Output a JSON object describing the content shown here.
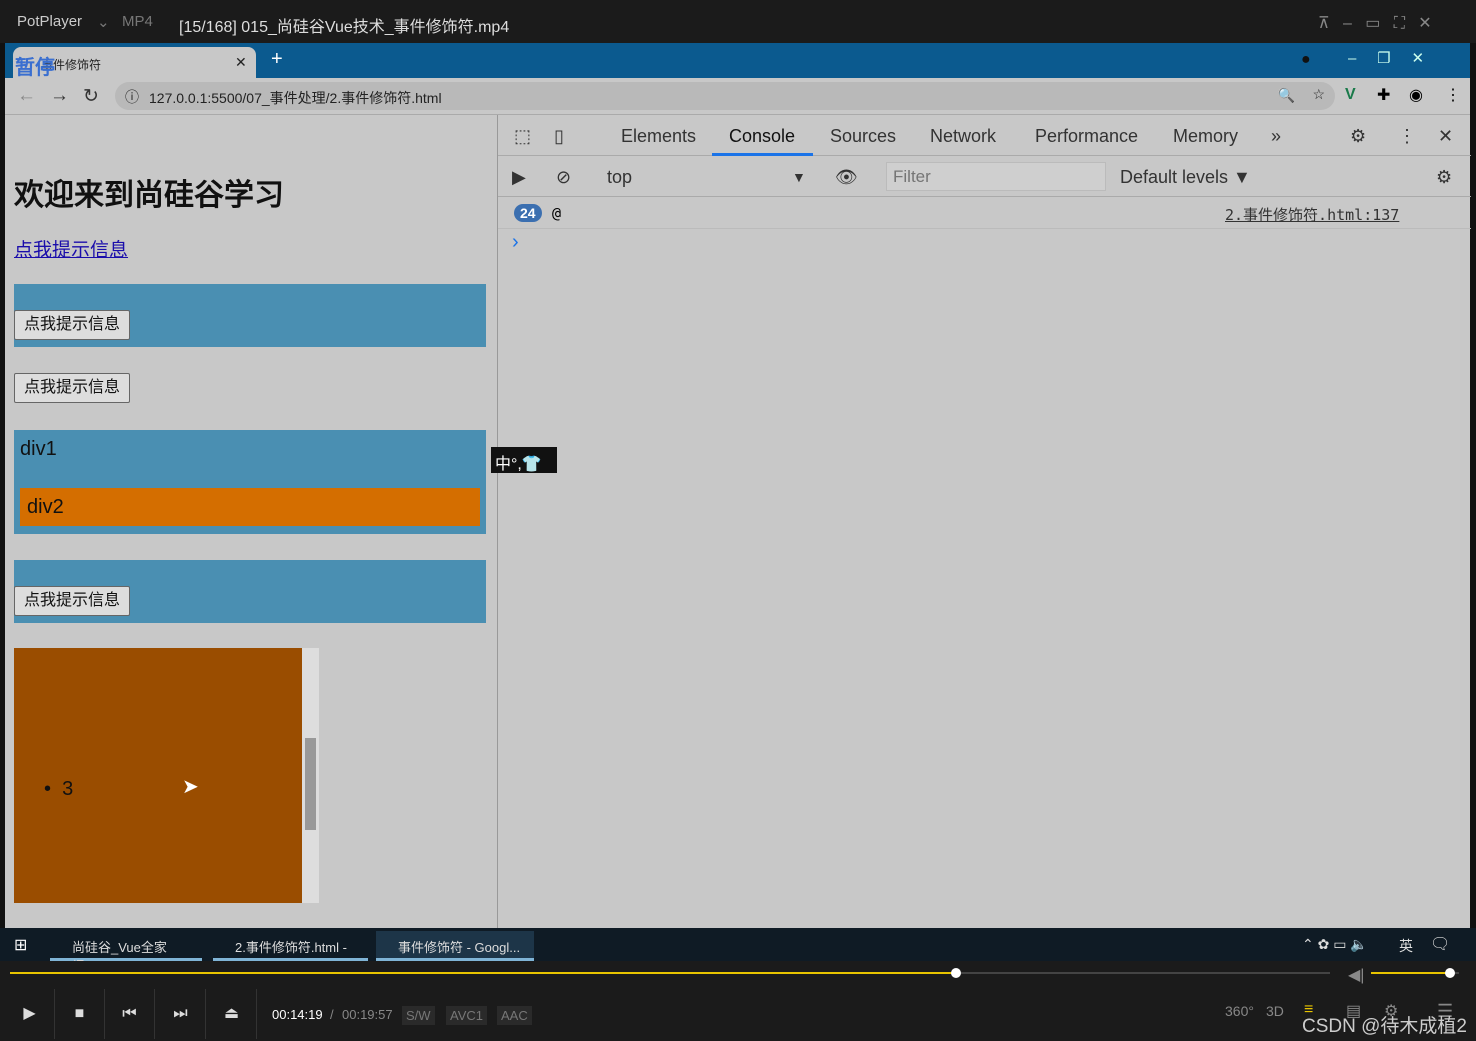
{
  "player": {
    "app_name": "PotPlayer",
    "format": "MP4",
    "title": "[15/168] 015_尚硅谷Vue技术_事件修饰符.mp4",
    "time_current": "00:14:19",
    "time_total": "00:19:57",
    "tags": [
      "S/W",
      "AVC1",
      "AAC"
    ],
    "progress": 0.717,
    "volume": 0.9,
    "paused_overlay": "暂停",
    "watermark": "CSDN @待木成植2",
    "accent": "#e8c400"
  },
  "browser": {
    "tab_title": "事件修饰符",
    "url": "127.0.0.1:5500/07_事件处理/2.事件修饰符.html"
  },
  "page": {
    "heading": "欢迎来到尚硅谷学习",
    "link": "点我提示信息",
    "button": "点我提示信息",
    "div1": "div1",
    "div2": "div2",
    "list_item": "3"
  },
  "devtools": {
    "tabs": [
      "Elements",
      "Console",
      "Sources",
      "Network",
      "Performance",
      "Memory"
    ],
    "active_tab": "Console",
    "context": "top",
    "filter_placeholder": "Filter",
    "levels": "Default levels ▼",
    "log_count": "24",
    "log_text": "@",
    "log_source": "2.事件修饰符.html:137",
    "prompt": "›"
  },
  "ime": "中°,👕",
  "taskbar": {
    "items": [
      "尚硅谷_Vue全家桶.d...",
      "2.事件修饰符.html - ...",
      "事件修饰符 - Googl..."
    ],
    "lang": "英"
  }
}
